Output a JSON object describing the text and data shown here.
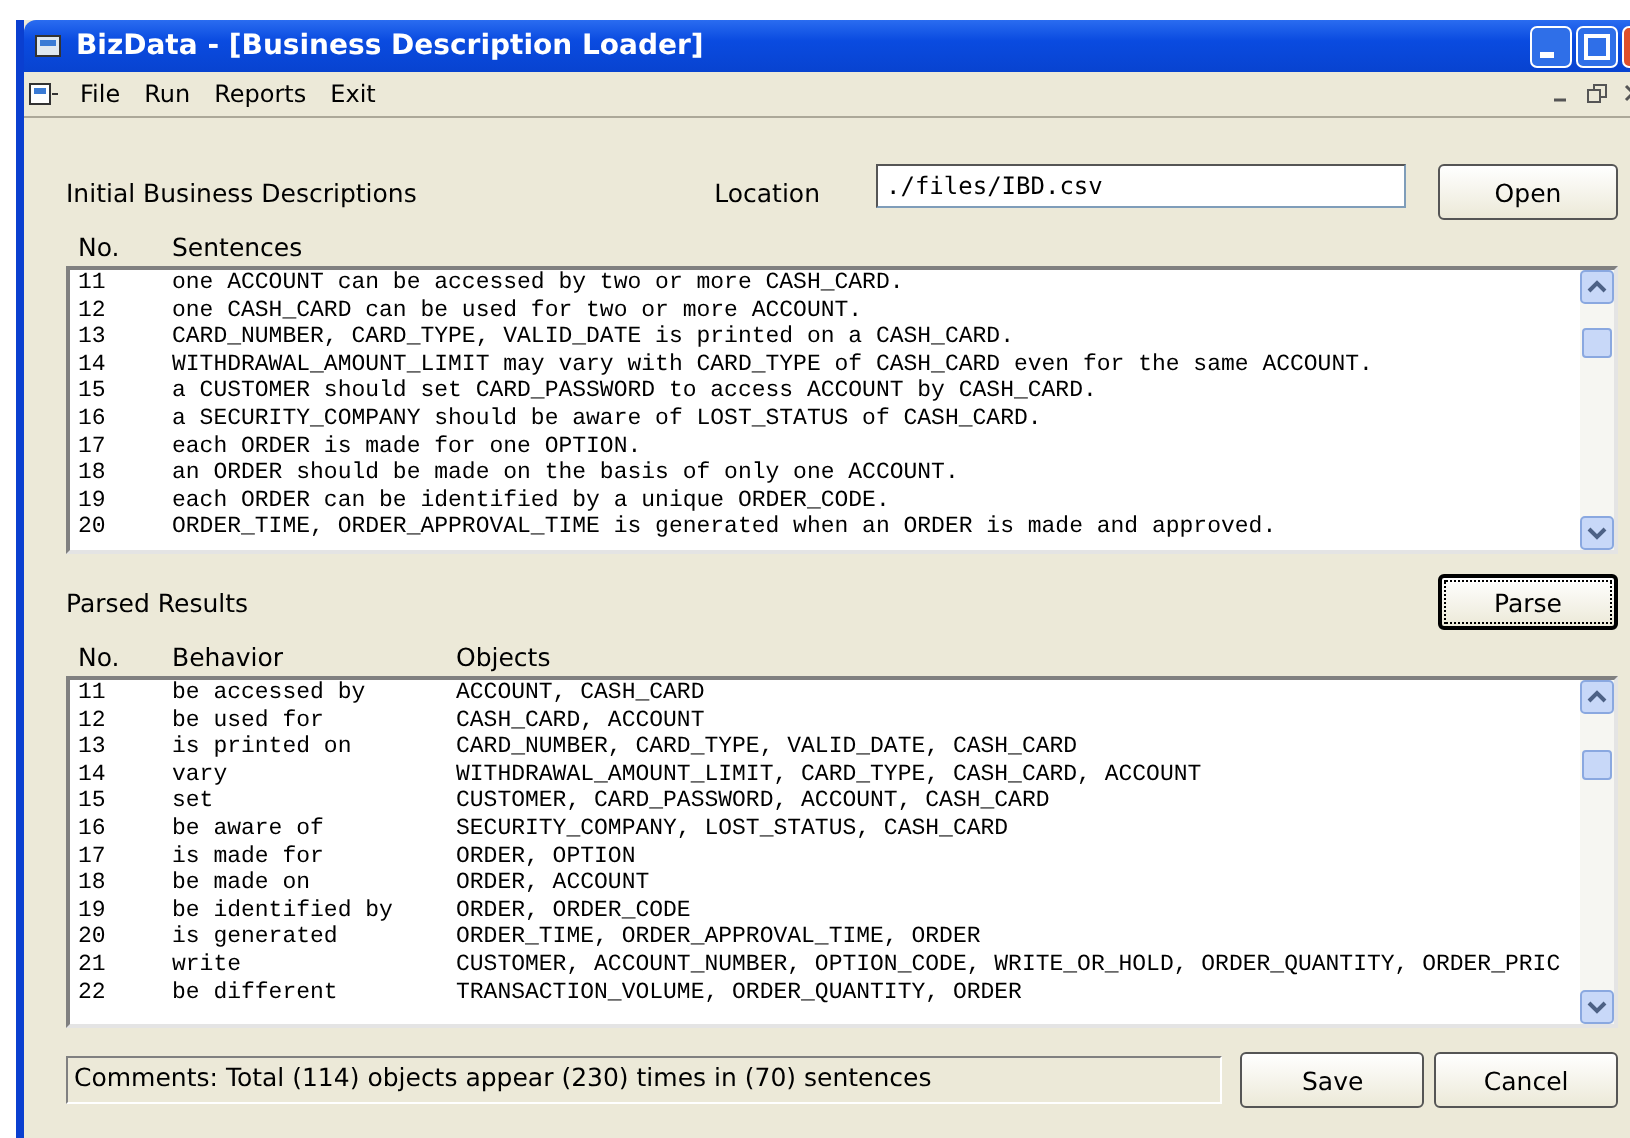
{
  "window": {
    "title": "BizData - [Business Description Loader]"
  },
  "menu": [
    "File",
    "Run",
    "Reports",
    "Exit"
  ],
  "descriptions": {
    "label": "Initial Business Descriptions",
    "location_label": "Location",
    "location": "./files/IBD.csv",
    "open_button": "Open",
    "columns": [
      "No.",
      "Sentences"
    ],
    "rows": [
      {
        "no": "11",
        "text": "one ACCOUNT can be accessed by two or more CASH_CARD."
      },
      {
        "no": "12",
        "text": "one CASH_CARD can be used for two or more ACCOUNT."
      },
      {
        "no": "13",
        "text": "CARD_NUMBER, CARD_TYPE, VALID_DATE is printed on a CASH_CARD."
      },
      {
        "no": "14",
        "text": "WITHDRAWAL_AMOUNT_LIMIT may vary with CARD_TYPE of CASH_CARD even for the same ACCOUNT."
      },
      {
        "no": "15",
        "text": "a CUSTOMER should set CARD_PASSWORD to access ACCOUNT by CASH_CARD."
      },
      {
        "no": "16",
        "text": "a SECURITY_COMPANY should be aware of LOST_STATUS of CASH_CARD."
      },
      {
        "no": "17",
        "text": "each ORDER is made for one OPTION."
      },
      {
        "no": "18",
        "text": "an ORDER should be made on the basis of only one ACCOUNT."
      },
      {
        "no": "19",
        "text": "each ORDER can be identified by a unique ORDER_CODE."
      },
      {
        "no": "20",
        "text": "ORDER_TIME, ORDER_APPROVAL_TIME is generated when an ORDER is made and approved."
      }
    ]
  },
  "parsed": {
    "label": "Parsed Results",
    "parse_button": {
      "label": "Parse",
      "focused": true
    },
    "columns": [
      "No.",
      "Behavior",
      "Objects"
    ],
    "rows": [
      {
        "no": "11",
        "behavior": "be accessed by",
        "objects": "ACCOUNT, CASH_CARD"
      },
      {
        "no": "12",
        "behavior": "be used for",
        "objects": "CASH_CARD, ACCOUNT"
      },
      {
        "no": "13",
        "behavior": "is printed on",
        "objects": "CARD_NUMBER, CARD_TYPE, VALID_DATE, CASH_CARD"
      },
      {
        "no": "14",
        "behavior": "vary",
        "objects": "WITHDRAWAL_AMOUNT_LIMIT, CARD_TYPE, CASH_CARD, ACCOUNT"
      },
      {
        "no": "15",
        "behavior": "set",
        "objects": "CUSTOMER, CARD_PASSWORD, ACCOUNT, CASH_CARD"
      },
      {
        "no": "16",
        "behavior": "be aware of",
        "objects": "SECURITY_COMPANY, LOST_STATUS, CASH_CARD"
      },
      {
        "no": "17",
        "behavior": "is made for",
        "objects": "ORDER, OPTION"
      },
      {
        "no": "18",
        "behavior": "be made on",
        "objects": "ORDER, ACCOUNT"
      },
      {
        "no": "19",
        "behavior": "be identified by",
        "objects": "ORDER, ORDER_CODE"
      },
      {
        "no": "20",
        "behavior": "is generated",
        "objects": "ORDER_TIME, ORDER_APPROVAL_TIME, ORDER"
      },
      {
        "no": "21",
        "behavior": "write",
        "objects": "CUSTOMER, ACCOUNT_NUMBER, OPTION_CODE, WRITE_OR_HOLD, ORDER_QUANTITY, ORDER_PRIC"
      },
      {
        "no": "22",
        "behavior": "be different",
        "objects": "TRANSACTION_VOLUME, ORDER_QUANTITY, ORDER"
      }
    ]
  },
  "comments": "Comments: Total (114) objects appear (230) times in (70) sentences",
  "buttons": [
    "Save",
    "Cancel"
  ]
}
